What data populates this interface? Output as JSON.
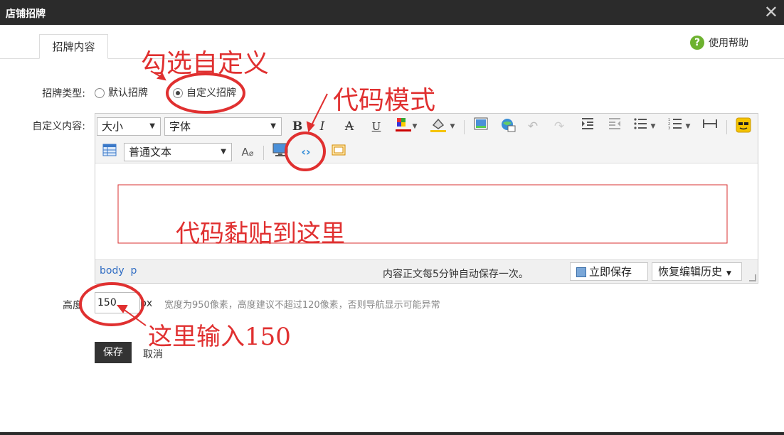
{
  "window": {
    "title": "店铺招牌",
    "close_glyph": "✕"
  },
  "tabs": [
    {
      "label": "招牌内容"
    }
  ],
  "help": {
    "label": "使用帮助",
    "icon_glyph": "?"
  },
  "form": {
    "sign_type_label": "招牌类型:",
    "options": [
      {
        "label": "默认招牌",
        "checked": false
      },
      {
        "label": "自定义招牌",
        "checked": true
      }
    ],
    "content_label": "自定义内容:",
    "height_label": "高度",
    "height_value": "150",
    "height_unit": "px",
    "hint": "宽度为950像素，高度建议不超过120像素，否则导航显示可能异常",
    "save_label": "保存",
    "cancel_label": "取消"
  },
  "editor": {
    "size_select": "大小",
    "font_select": "字体",
    "format_select": "普通文本",
    "path": [
      "body",
      "p"
    ],
    "autosave_text": "内容正文每5分钟自动保存一次。",
    "save_now_label": "立即保存",
    "history_label": "恢复编辑历史"
  },
  "annotations": {
    "check_custom": "勾选自定义",
    "code_mode": "代码模式",
    "paste_here": "代码黏贴到这里",
    "input_150": "这里输入150"
  },
  "colors": {
    "annotation": "#e03030",
    "titlebar": "#2b2b2b",
    "accent_green": "#6db22f"
  }
}
